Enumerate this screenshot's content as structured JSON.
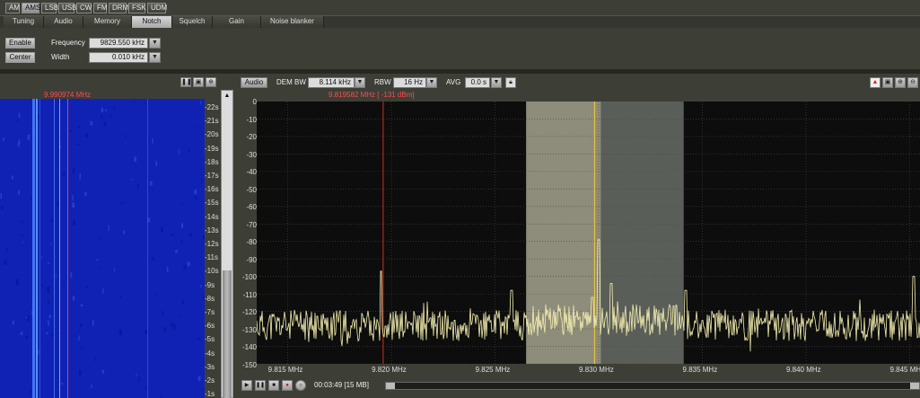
{
  "modes": [
    "AM",
    "AMS",
    "LSB",
    "USB",
    "CW",
    "FM",
    "DRM",
    "FSK",
    "UDM"
  ],
  "active_mode": "AMS",
  "tabs": [
    "Tuning",
    "Audio",
    "Memory",
    "Notch",
    "Squelch",
    "Gain",
    "Noise blanker"
  ],
  "active_tab": "Notch",
  "notch": {
    "enable_label": "Enable",
    "center_label": "Center",
    "frequency_label": "Frequency",
    "frequency_value": "9829.550 kHz",
    "width_label": "Width",
    "width_value": "0.010 kHz"
  },
  "waterfall": {
    "cursor_freq": "9.990974 MHz",
    "time_ticks": [
      "22s",
      "21s",
      "20s",
      "19s",
      "18s",
      "17s",
      "16s",
      "15s",
      "14s",
      "13s",
      "12s",
      "11s",
      "10s",
      "9s",
      "8s",
      "7s",
      "6s",
      "5s",
      "4s",
      "3s",
      "2s",
      "1s"
    ]
  },
  "spectrum": {
    "audio_label": "Audio",
    "dem_bw_label": "DEM BW",
    "dem_bw_value": "8.114 kHz",
    "rbw_label": "RBW",
    "rbw_value": "16 Hz",
    "avg_label": "AVG",
    "avg_value": "0.0 s",
    "cursor_readout": "9.819582 MHz [ -131 dBm]",
    "db_ticks": [
      "0",
      "-10",
      "-20",
      "-30",
      "-40",
      "-50",
      "-60",
      "-70",
      "-80",
      "-90",
      "-100",
      "-110",
      "-120",
      "-130",
      "-140",
      "-150"
    ],
    "freq_ticks": [
      "9.815 MHz",
      "9.820 MHz",
      "9.825 MHz",
      "9.830 MHz",
      "9.835 MHz",
      "9.840 MHz",
      "9.845 MHz"
    ],
    "x_range": [
      9.8135,
      9.8455
    ],
    "y_range": [
      -150,
      0
    ],
    "passband": [
      9.8265,
      9.8341
    ],
    "notch_band": [
      9.8265,
      9.8301
    ],
    "tuned_freq": 9.8298,
    "cursor_marker": 9.8196,
    "colors": {
      "trace": "#f6f0b0",
      "cursor": "#d62a2a",
      "tuned": "#e8c23a",
      "band_light": "#8e8c7a",
      "band_dark": "#5a5e58"
    }
  },
  "transport": {
    "time_label": "00:03:49",
    "size_label": "[15 MB]"
  }
}
